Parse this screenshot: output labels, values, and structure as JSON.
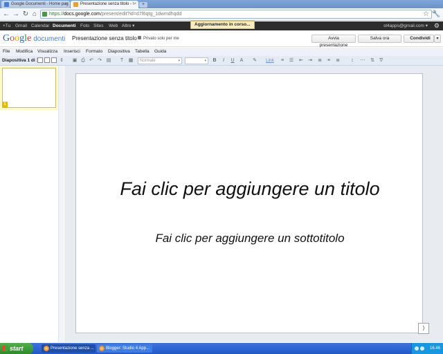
{
  "browser": {
    "tabs": [
      {
        "title": "Google Documenti - Home pag",
        "active": false
      },
      {
        "title": "Presentazione senza titolo - \\",
        "active": true
      }
    ],
    "url_scheme": "https://",
    "url_host": "docs.google.com",
    "url_path": "/present/edit?id=d7f6qtg_1dwmdhqdd"
  },
  "gbar": {
    "links": [
      "+Tu",
      "Gmail",
      "Calendar",
      "Documenti",
      "Foto",
      "Sites",
      "Web",
      "Altro ▾"
    ],
    "active": "Documenti",
    "user": "st4apps@gmail.com ▾",
    "status": "Aggiornamento in corso..."
  },
  "header": {
    "logo_letters": [
      "G",
      "o",
      "o",
      "g",
      "l",
      "e"
    ],
    "logo_product": "documenti",
    "doc_title": "Presentazione senza titolo",
    "privacy": "Privato solo per me",
    "start_presentation": "Avvia presentazione",
    "save_now": "Salva ora",
    "share": "Condividi"
  },
  "menu": [
    "File",
    "Modifica",
    "Visualizza",
    "Inserisci",
    "Formato",
    "Diapositiva",
    "Tabella",
    "Guida"
  ],
  "toolbar": {
    "slide_count": "Diapositiva 1 di 1",
    "style_select": "Normale",
    "link_label": "Link",
    "bold": "B",
    "italic": "I",
    "underline": "U",
    "text_color": "A"
  },
  "sidebar": {
    "slides": [
      {
        "number": "1"
      }
    ]
  },
  "slide": {
    "title": "Fai clic per aggiungere un titolo",
    "subtitle": "Fai clic per aggiungere un sottotitolo"
  },
  "taskbar": {
    "start": "start",
    "items": [
      "Presentazione senza ...",
      "Blogger: Studio 4 App..."
    ],
    "clock": "16.46"
  }
}
